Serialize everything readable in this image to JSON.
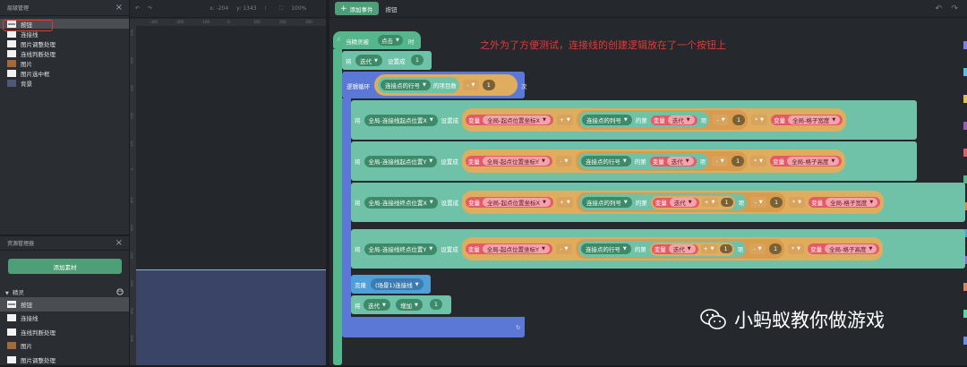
{
  "layers": {
    "title": "层级管理",
    "items": [
      {
        "label": "按钮",
        "thumb": "btn"
      },
      {
        "label": "连接线",
        "thumb": "white"
      },
      {
        "label": "图片调整处理",
        "thumb": "white"
      },
      {
        "label": "连线判断处理",
        "thumb": "white"
      },
      {
        "label": "图片",
        "thumb": "brown"
      },
      {
        "label": "图片选中框",
        "thumb": "white"
      },
      {
        "label": "背景",
        "thumb": "bg"
      }
    ]
  },
  "assets": {
    "title": "资源管理器",
    "add_label": "添加素材",
    "sprites_title": "精灵",
    "items": [
      {
        "label": "按钮",
        "thumb": "btn"
      },
      {
        "label": "连接线",
        "thumb": "white"
      },
      {
        "label": "连线判断处理",
        "thumb": "white"
      },
      {
        "label": "图片",
        "thumb": "brown"
      },
      {
        "label": "图片调整处理",
        "thumb": "white"
      }
    ]
  },
  "canvas": {
    "coord_x": "x: -204",
    "coord_y": "y: 1343",
    "zoom": "100%",
    "ruler_top": [
      "-300",
      "-200",
      "-100",
      "0",
      "100",
      "200",
      "300"
    ],
    "ruler_left": [
      "500",
      "400",
      "300",
      "200",
      "100",
      "0",
      "-100",
      "-200",
      "-300",
      "-400",
      "-500",
      "-600"
    ]
  },
  "editor": {
    "add_event_label": "添加事件",
    "tab_label": "按钮",
    "annotation": "之外为了方便测试，连接线的创建逻辑放在了一个按钮上",
    "watermark": "小蚂蚁教你做游戏",
    "event": {
      "when": "当精灵被",
      "trigger": "点击",
      "then": "时"
    },
    "init": {
      "set": "将",
      "var": "迭代",
      "to": "设置成",
      "value": "1"
    },
    "loop": {
      "label": "逻辑循环",
      "list": "连接点的行号",
      "count": "的项目数",
      "op": "-",
      "value": "1",
      "times": "次"
    },
    "rows": [
      {
        "set": "将",
        "target": "全局-连接线起点位置X",
        "to": "设置成",
        "var_kw": "变量",
        "var": "全局-起点位置坐标X",
        "op1": "+",
        "list": "连接点的列号",
        "nth": "的第",
        "idx_kw": "变量",
        "idx": "迭代",
        "item": "项",
        "op2": "-",
        "n": "1",
        "op3": "*",
        "var2_kw": "变量",
        "var2": "全局-格子宽度"
      },
      {
        "set": "将",
        "target": "全局-连接线起点位置Y",
        "to": "设置成",
        "var_kw": "变量",
        "var": "全局-起点位置坐标Y",
        "op1": "-",
        "list": "连接点的行号",
        "nth": "的第",
        "idx_kw": "变量",
        "idx": "迭代",
        "item": "项",
        "op2": "-",
        "n": "1",
        "op3": "*",
        "var2_kw": "变量",
        "var2": "全局-格子高度"
      },
      {
        "set": "将",
        "target": "全局-连接线终点位置X",
        "to": "设置成",
        "var_kw": "变量",
        "var": "全局-起点位置坐标X",
        "op1": "+",
        "list": "连接点的列号",
        "nth": "的第",
        "idx_kw": "变量",
        "idx": "迭代",
        "plus": "+",
        "plus_n": "1",
        "item": "项",
        "op2": "-",
        "n": "1",
        "op3": "*",
        "var2_kw": "变量",
        "var2": "全局-格子宽度"
      },
      {
        "set": "将",
        "target": "全局-连接线终点位置Y",
        "to": "设置成",
        "var_kw": "变量",
        "var": "全局-起点位置坐标Y",
        "op1": "-",
        "list": "连接点的行号",
        "nth": "的第",
        "idx_kw": "变量",
        "idx": "迭代",
        "plus": "+",
        "plus_n": "1",
        "item": "项",
        "op2": "-",
        "n": "1",
        "op3": "*",
        "var2_kw": "变量",
        "var2": "全局-格子高度"
      }
    ],
    "clone": {
      "label": "克隆",
      "target": "(场景1)连接线"
    },
    "inc": {
      "set": "将",
      "var": "迭代",
      "by": "增加",
      "value": "1"
    }
  },
  "colors": {
    "event": "#55b58b",
    "block": "#6fc2a8",
    "loop": "#5b78d6",
    "cmp": "#e0ad5e",
    "var": "#e55a67",
    "highlight": "#e53935"
  }
}
